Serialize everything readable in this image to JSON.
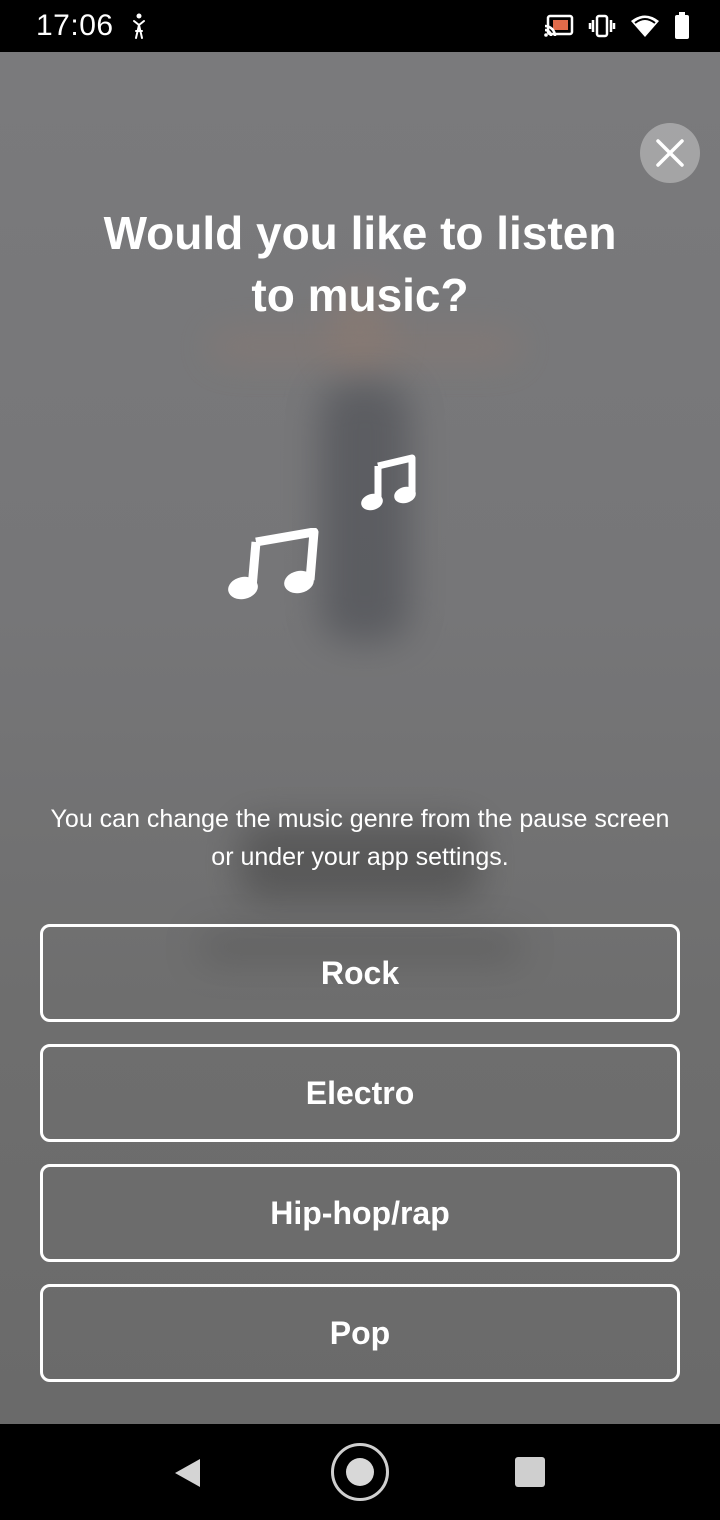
{
  "status_bar": {
    "time": "17:06",
    "left_icon": "figure-icon",
    "right_icons": [
      "cast-icon",
      "vibrate-icon",
      "wifi-icon",
      "battery-icon"
    ]
  },
  "dialog": {
    "close_icon": "close-icon",
    "title_line1": "Would you like to listen",
    "title_line2": "to music?",
    "illustration_icons": [
      "music-note-small-icon",
      "music-note-large-icon"
    ],
    "subtitle": "You can change the music genre from the pause screen or under your app settings.",
    "genres": [
      {
        "label": "Rock"
      },
      {
        "label": "Electro"
      },
      {
        "label": "Hip-hop/rap"
      },
      {
        "label": "Pop"
      }
    ]
  },
  "nav_bar": {
    "icons": [
      "back-icon",
      "home-icon",
      "recents-icon"
    ]
  },
  "colors": {
    "status_bar_bg": "#000000",
    "overlay_bg": "#767676",
    "text": "#ffffff",
    "button_border": "#ffffff"
  }
}
